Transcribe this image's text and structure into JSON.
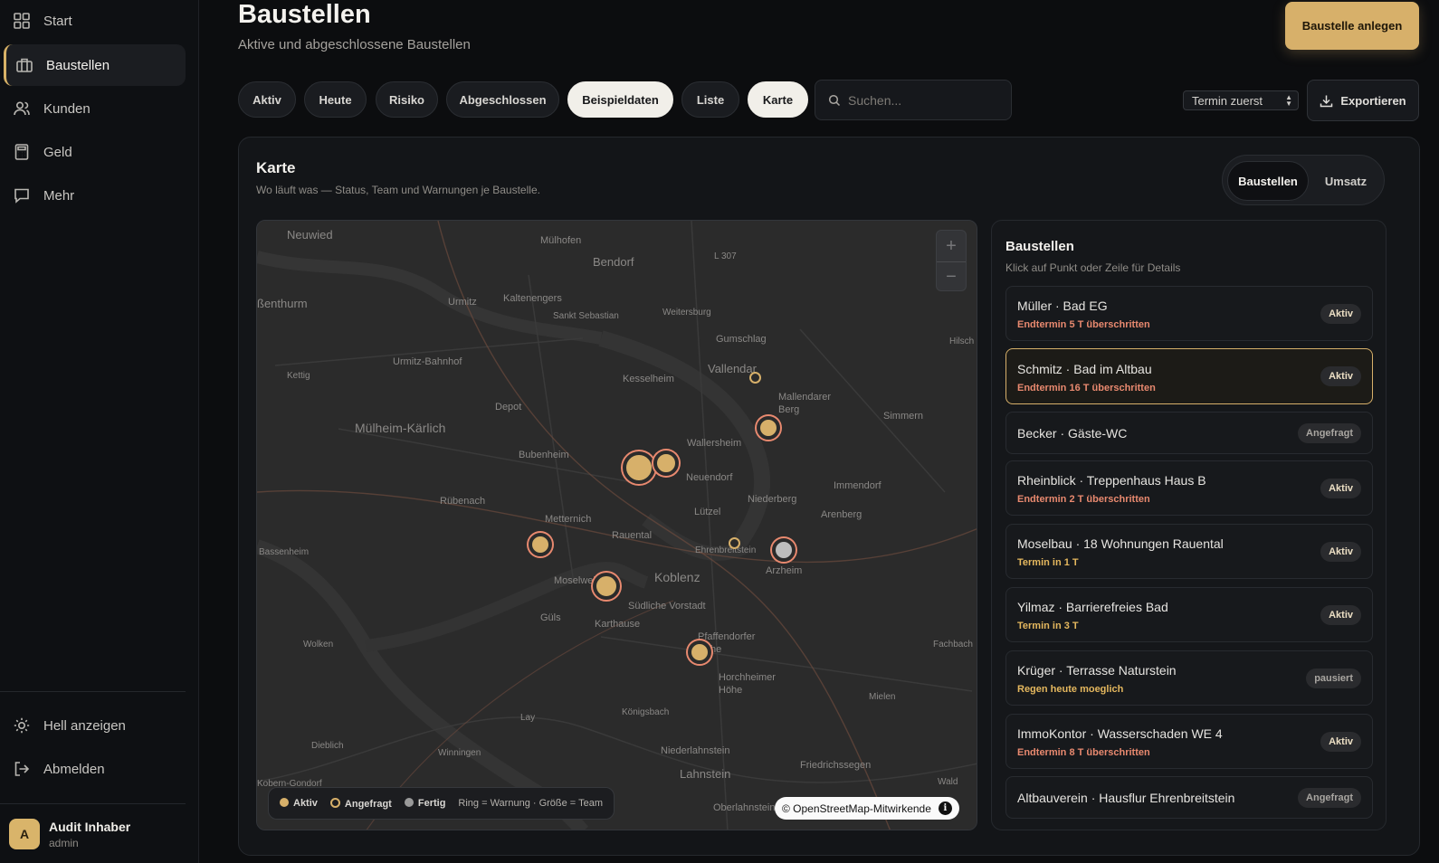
{
  "sidebar": {
    "items": [
      {
        "label": "Start",
        "icon": "grid-icon"
      },
      {
        "label": "Baustellen",
        "icon": "briefcase-icon"
      },
      {
        "label": "Kunden",
        "icon": "users-icon"
      },
      {
        "label": "Geld",
        "icon": "calculator-icon"
      },
      {
        "label": "Mehr",
        "icon": "message-icon"
      }
    ],
    "bottom": [
      {
        "label": "Hell anzeigen",
        "icon": "sun-icon"
      },
      {
        "label": "Abmelden",
        "icon": "logout-icon"
      }
    ],
    "user": {
      "initial": "A",
      "name": "Audit Inhaber",
      "role": "admin"
    }
  },
  "header": {
    "title": "Baustellen",
    "subtitle": "Aktive und abgeschlossene Baustellen",
    "primary_button": "Baustelle anlegen"
  },
  "filters": [
    {
      "label": "Aktiv",
      "active": false
    },
    {
      "label": "Heute",
      "active": false
    },
    {
      "label": "Risiko",
      "active": false
    },
    {
      "label": "Abgeschlossen",
      "active": false
    },
    {
      "label": "Beispieldaten",
      "active": true
    },
    {
      "label": "Liste",
      "active": false
    },
    {
      "label": "Karte",
      "active": true
    }
  ],
  "search": {
    "placeholder": "Suchen...",
    "value": ""
  },
  "sort": {
    "selected": "Termin zuerst"
  },
  "export_label": "Exportieren",
  "panel": {
    "title": "Karte",
    "subtitle": "Wo läuft was — Status, Team und Warnungen je Baustelle.",
    "toggle": [
      {
        "label": "Baustellen",
        "active": true
      },
      {
        "label": "Umsatz",
        "active": false
      }
    ]
  },
  "map": {
    "zoom_in": "+",
    "zoom_out": "−",
    "places": [
      "Neuwied",
      "Mülhofen",
      "Bendorf",
      "L 307",
      "ßenthurm",
      "Urmitz",
      "Kaltenengers",
      "Sankt Sebastian",
      "Weitersburg",
      "Hilsch",
      "Gumschlag",
      "Kettig",
      "Urmitz-Bahnhof",
      "Kesselheim",
      "Vallendar",
      "Mallendarer Berg",
      "Depot",
      "Mülheim-Kärlich",
      "Simmern",
      "Wallersheim",
      "Bubenheim",
      "Neuendorf",
      "Immendorf",
      "Rübenach",
      "Lützel",
      "Niederberg",
      "Metternich",
      "Arenberg",
      "Rauental",
      "Bassenheim",
      "Ehrenbreitstein",
      "Arzheim",
      "Moselweiß",
      "Koblenz",
      "Südliche Vorstadt",
      "Güls",
      "Karthause",
      "Pfaffendorfer Höhe",
      "Wolken",
      "Fachbach",
      "Horchheimer Höhe",
      "Königsbach",
      "Mielen",
      "Lay",
      "Dieblich",
      "Winningen",
      "Niederlahnstein",
      "Friedrichssegen",
      "Lahnstein",
      "Kobern-Gondorf",
      "Oberlahnstein",
      "Wald"
    ],
    "legend": {
      "active": "Aktiv",
      "requested": "Angefragt",
      "done": "Fertig",
      "hint": "Ring = Warnung · Größe = Team"
    },
    "attribution": "© OpenStreetMap-Mitwirkende",
    "info": "i"
  },
  "list": {
    "title": "Baustellen",
    "subtitle": "Klick auf Punkt oder Zeile für Details",
    "rows": [
      {
        "title": "Müller · Bad EG",
        "warning": "Endtermin 5 T überschritten",
        "warn_level": "red",
        "status": "Aktiv",
        "selected": false
      },
      {
        "title": "Schmitz · Bad im Altbau",
        "warning": "Endtermin 16 T überschritten",
        "warn_level": "red",
        "status": "Aktiv",
        "selected": true
      },
      {
        "title": "Becker · Gäste-WC",
        "warning": "",
        "warn_level": "",
        "status": "Angefragt",
        "selected": false
      },
      {
        "title": "Rheinblick · Treppenhaus Haus B",
        "warning": "Endtermin 2 T überschritten",
        "warn_level": "red",
        "status": "Aktiv",
        "selected": false
      },
      {
        "title": "Moselbau · 18 Wohnungen Rauental",
        "warning": "Termin in 1 T",
        "warn_level": "amber",
        "status": "Aktiv",
        "selected": false
      },
      {
        "title": "Yilmaz · Barrierefreies Bad",
        "warning": "Termin in 3 T",
        "warn_level": "amber",
        "status": "Aktiv",
        "selected": false
      },
      {
        "title": "Krüger · Terrasse Naturstein",
        "warning": "Regen heute moeglich",
        "warn_level": "amber",
        "status": "pausiert",
        "selected": false
      },
      {
        "title": "ImmoKontor · Wasserschaden WE 4",
        "warning": "Endtermin 8 T überschritten",
        "warn_level": "red",
        "status": "Aktiv",
        "selected": false
      },
      {
        "title": "Altbauverein · Hausflur Ehrenbreitstein",
        "warning": "",
        "warn_level": "",
        "status": "Angefragt",
        "selected": false
      }
    ]
  },
  "colors": {
    "accent": "#d7b06a",
    "warn_red": "#e8896f",
    "warn_amber": "#e4b75e",
    "done_grey": "#bdbdbd"
  }
}
